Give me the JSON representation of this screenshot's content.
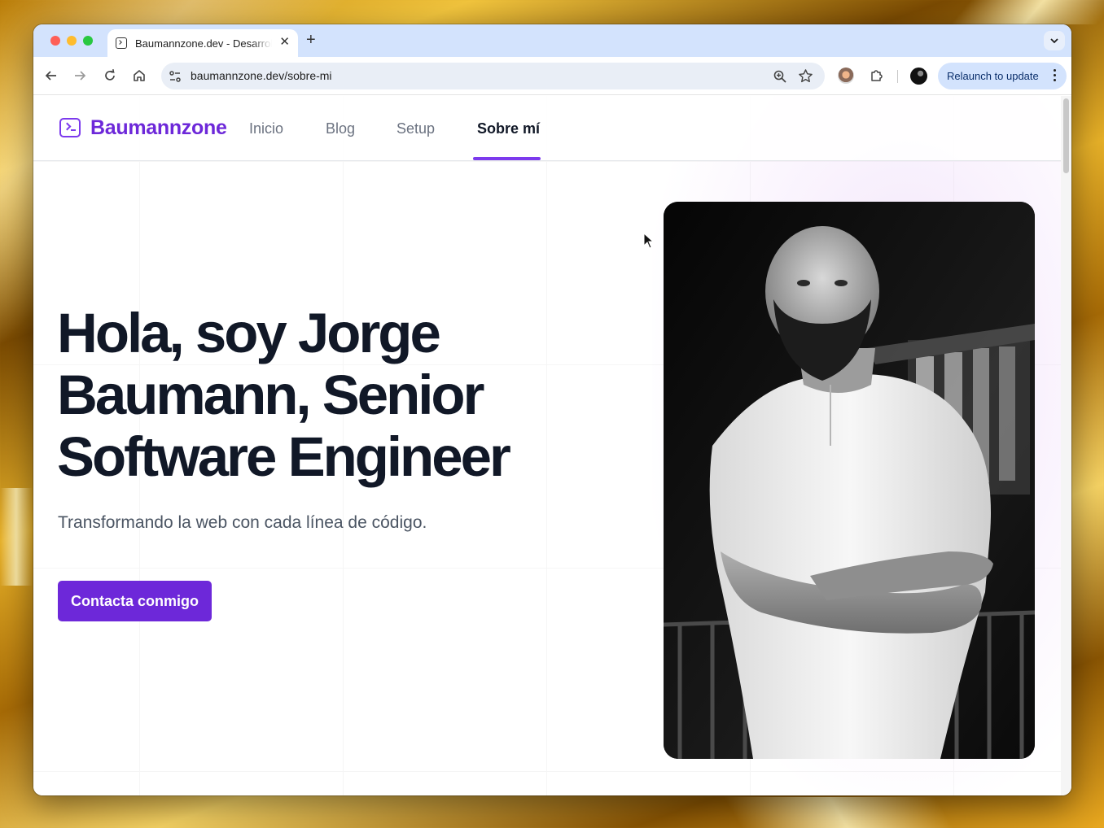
{
  "browser": {
    "tab_title": "Baumannzone.dev - Desarrollador",
    "new_tab": "+",
    "tab_close": "✕",
    "url": "baumannzone.dev/sobre-mi",
    "relaunch_label": "Relaunch to update"
  },
  "site": {
    "logo_text": "Baumannzone",
    "nav": [
      {
        "label": "Inicio",
        "active": false
      },
      {
        "label": "Blog",
        "active": false
      },
      {
        "label": "Setup",
        "active": false
      },
      {
        "label": "Sobre mí",
        "active": true
      }
    ]
  },
  "hero": {
    "title": "Hola, soy Jorge Baumann, Senior Software Engineer",
    "subtitle": "Transformando la web con cada línea de código.",
    "cta_label": "Contacta conmigo"
  },
  "photo": {
    "description_icon": "portrait-photo",
    "style": "black-and-white"
  },
  "colors": {
    "accent": "#6d28d9",
    "heading": "#111827",
    "muted": "#6b7280",
    "tabstrip": "#d3e3fd"
  }
}
